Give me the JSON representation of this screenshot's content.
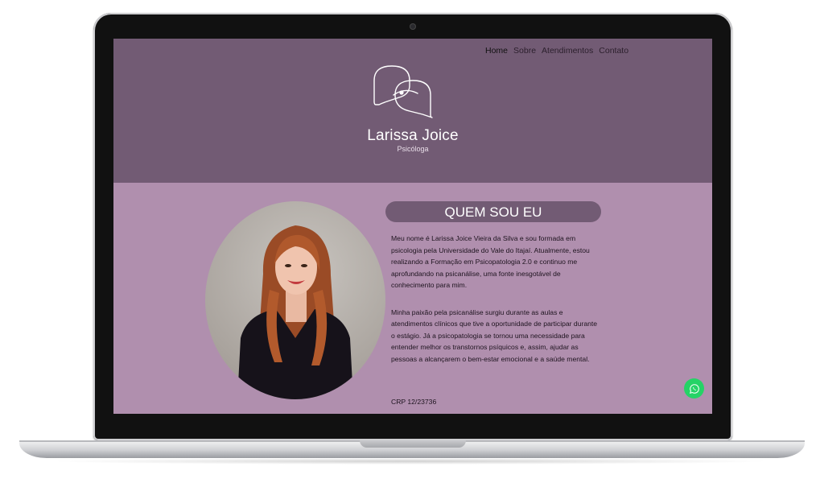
{
  "nav": {
    "items": [
      {
        "label": "Home",
        "active": true
      },
      {
        "label": "Sobre",
        "active": false
      },
      {
        "label": "Atendimentos",
        "active": false
      },
      {
        "label": "Contato",
        "active": false
      }
    ]
  },
  "brand": {
    "name": "Larissa Joice",
    "subtitle": "Psicóloga"
  },
  "about": {
    "title": "QUEM SOU EU",
    "paragraphs": [
      "Meu nome é Larissa Joice Vieira da Silva e sou formada em psicologia pela Universidade do Vale do Itajaí. Atualmente, estou realizando a Formação em Psicopatologia 2.0 e continuo me aprofundando na psicanálise, uma fonte inesgotável de conhecimento para mim.",
      "Minha paixão pela psicanálise surgiu durante as aulas e atendimentos clínicos que tive a oportunidade de participar durante o estágio. Já a psicopatologia se tornou uma necessidade para entender melhor os transtornos psíquicos e, assim, ajudar as pessoas a alcançarem o bem-estar emocional e a saúde mental."
    ],
    "crp": "CRP 12/23736"
  },
  "colors": {
    "header": "#725b74",
    "body": "#b08fae",
    "whatsapp": "#25d366"
  },
  "icons": {
    "logo": "speech-bubbles-logo",
    "float_button": "whatsapp-icon"
  }
}
